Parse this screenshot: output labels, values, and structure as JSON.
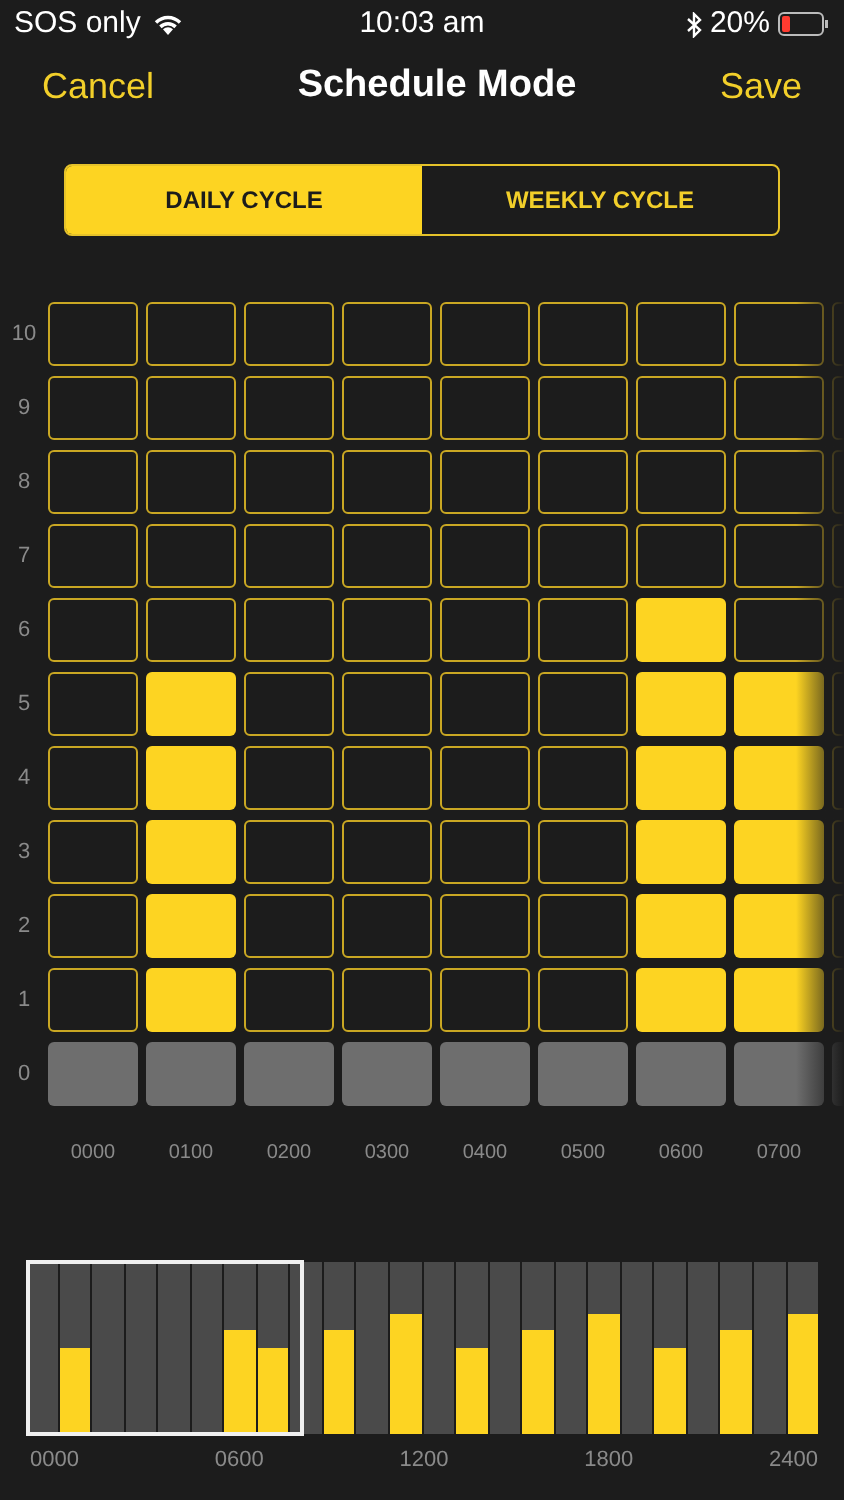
{
  "status_bar": {
    "carrier": "SOS only",
    "time": "10:03 am",
    "battery": "20%"
  },
  "nav": {
    "cancel": "Cancel",
    "title": "Schedule Mode",
    "save": "Save"
  },
  "tabs": [
    {
      "label": "DAILY CYCLE",
      "selected": true
    },
    {
      "label": "WEEKLY CYCLE",
      "selected": false
    }
  ],
  "grid": {
    "row_labels": [
      "10",
      "9",
      "8",
      "7",
      "6",
      "5",
      "4",
      "3",
      "2",
      "1",
      "0"
    ],
    "columns": [
      {
        "label": "0000",
        "cells": [
          {
            "on": false
          },
          {
            "on": false
          },
          {
            "on": false
          },
          {
            "on": false
          },
          {
            "on": false
          },
          {
            "on": false
          },
          {
            "on": false
          },
          {
            "on": false
          },
          {
            "on": false
          },
          {
            "on": false
          }
        ]
      },
      {
        "label": "0100",
        "cells": [
          {
            "on": false
          },
          {
            "on": false
          },
          {
            "on": false
          },
          {
            "on": false
          },
          {
            "on": false
          },
          {
            "on": true
          },
          {
            "on": true
          },
          {
            "on": true
          },
          {
            "on": true
          },
          {
            "on": true
          }
        ]
      },
      {
        "label": "0200",
        "cells": [
          {
            "on": false
          },
          {
            "on": false
          },
          {
            "on": false
          },
          {
            "on": false
          },
          {
            "on": false
          },
          {
            "on": false
          },
          {
            "on": false
          },
          {
            "on": false
          },
          {
            "on": false
          },
          {
            "on": false
          }
        ]
      },
      {
        "label": "0300",
        "cells": [
          {
            "on": false
          },
          {
            "on": false
          },
          {
            "on": false
          },
          {
            "on": false
          },
          {
            "on": false
          },
          {
            "on": false
          },
          {
            "on": false
          },
          {
            "on": false
          },
          {
            "on": false
          },
          {
            "on": false
          }
        ]
      },
      {
        "label": "0400",
        "cells": [
          {
            "on": false
          },
          {
            "on": false
          },
          {
            "on": false
          },
          {
            "on": false
          },
          {
            "on": false
          },
          {
            "on": false
          },
          {
            "on": false
          },
          {
            "on": false
          },
          {
            "on": false
          },
          {
            "on": false
          }
        ]
      },
      {
        "label": "0500",
        "cells": [
          {
            "on": false
          },
          {
            "on": false
          },
          {
            "on": false
          },
          {
            "on": false
          },
          {
            "on": false
          },
          {
            "on": false
          },
          {
            "on": false
          },
          {
            "on": false
          },
          {
            "on": false
          },
          {
            "on": false
          }
        ]
      },
      {
        "label": "0600",
        "cells": [
          {
            "on": false
          },
          {
            "on": false
          },
          {
            "on": false
          },
          {
            "on": false
          },
          {
            "on": true
          },
          {
            "on": true
          },
          {
            "on": true
          },
          {
            "on": true
          },
          {
            "on": true
          },
          {
            "on": true
          }
        ]
      },
      {
        "label": "0700",
        "cells": [
          {
            "on": false
          },
          {
            "on": false
          },
          {
            "on": false
          },
          {
            "on": false
          },
          {
            "on": false
          },
          {
            "on": true
          },
          {
            "on": true
          },
          {
            "on": true
          },
          {
            "on": true
          },
          {
            "on": true
          }
        ]
      },
      {
        "cells": [
          {
            "on": false
          },
          {
            "on": false
          },
          {
            "on": false
          },
          {
            "on": false
          },
          {
            "on": false
          },
          {
            "on": false
          },
          {
            "on": false
          },
          {
            "on": false
          },
          {
            "on": false
          },
          {
            "on": false
          }
        ]
      }
    ]
  },
  "overview": {
    "bars": [
      {
        "level": 0
      },
      {
        "level": 0.5
      },
      {
        "level": 0
      },
      {
        "level": 0
      },
      {
        "level": 0
      },
      {
        "level": 0
      },
      {
        "level": 0.6
      },
      {
        "level": 0.5
      },
      {
        "level": 0
      },
      {
        "level": 0.6
      },
      {
        "level": 0
      },
      {
        "level": 0.7
      },
      {
        "level": 0
      },
      {
        "level": 0.5
      },
      {
        "level": 0
      },
      {
        "level": 0.6
      },
      {
        "level": 0
      },
      {
        "level": 0.7
      },
      {
        "level": 0
      },
      {
        "level": 0.5
      },
      {
        "level": 0
      },
      {
        "level": 0.6
      },
      {
        "level": 0
      },
      {
        "level": 0.7
      }
    ],
    "axis_labels": [
      "0000",
      "0600",
      "1200",
      "1800",
      "2400"
    ]
  }
}
